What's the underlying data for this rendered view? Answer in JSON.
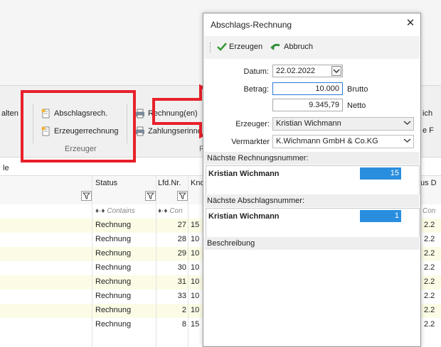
{
  "ribbon": {
    "partial_left": "alten",
    "abschlag_label": "Abschlagsrech.",
    "erzeuger_label": "Erzeugerrechnung",
    "group_label": "Erzeuger",
    "rechnungen_label": "Rechnung(en)",
    "zahlung_label": "Zahlungserinne",
    "group_r": "R",
    "partial_right1": "ich",
    "partial_right2": "e F",
    "left_fragment": "le"
  },
  "grid": {
    "columns": {
      "status": "Status",
      "lfdnr": "Lfd.Nr.",
      "knd": "Knd",
      "right_partial": "us D"
    },
    "filter_contains": "Contains",
    "filter_con": "Con",
    "filter_con_right": "Con",
    "rows": [
      {
        "status": "Rechnung",
        "lfd": "27",
        "knd": "15",
        "right": "2.2"
      },
      {
        "status": "Rechnung",
        "lfd": "28",
        "knd": "10",
        "right": "2.2"
      },
      {
        "status": "Rechnung",
        "lfd": "29",
        "knd": "10",
        "right": "2.2"
      },
      {
        "status": "Rechnung",
        "lfd": "30",
        "knd": "10",
        "right": "2.2"
      },
      {
        "status": "Rechnung",
        "lfd": "31",
        "knd": "10",
        "right": "2.2"
      },
      {
        "status": "Rechnung",
        "lfd": "33",
        "knd": "10",
        "right": "2.2"
      },
      {
        "status": "Rechnung",
        "lfd": "2",
        "knd": "10",
        "right": "2.2"
      },
      {
        "status": "Rechnung",
        "lfd": "8",
        "knd": "15",
        "right": "2.2"
      }
    ]
  },
  "dialog": {
    "title": "Abschlags-Rechnung",
    "close_glyph": "✕",
    "toolbar": {
      "erzeugen": "Erzeugen",
      "abbruch": "Abbruch"
    },
    "datum_label": "Datum:",
    "datum_value": "22.02.2022",
    "betrag_label": "Betrag:",
    "betrag_value": "10.000",
    "brutto_label": "Brutto",
    "netto_value": "9.345,79",
    "netto_label": "Netto",
    "erzeuger_label": "Erzeuger:",
    "erzeuger_value": "Kristian Wichmann",
    "vermarkter_label": "Vermarkter",
    "vermarkter_value": "K.Wichmann GmbH & Co.KG",
    "next_rechnung_header": "Nächste Rechnungsnummer:",
    "next_rechnung_name": "Kristian Wichmann",
    "next_rechnung_value": "15",
    "next_abschlag_header": "Nächste Abschlagsnummer:",
    "next_abschlag_name": "Kristian Wichmann",
    "next_abschlag_value": "1",
    "beschreibung_header": "Beschreibung"
  },
  "colors": {
    "highlight": "#e8202a",
    "bar": "#2a8ede",
    "row_yellow": "#fcfce6",
    "focus": "#2b79d6"
  }
}
